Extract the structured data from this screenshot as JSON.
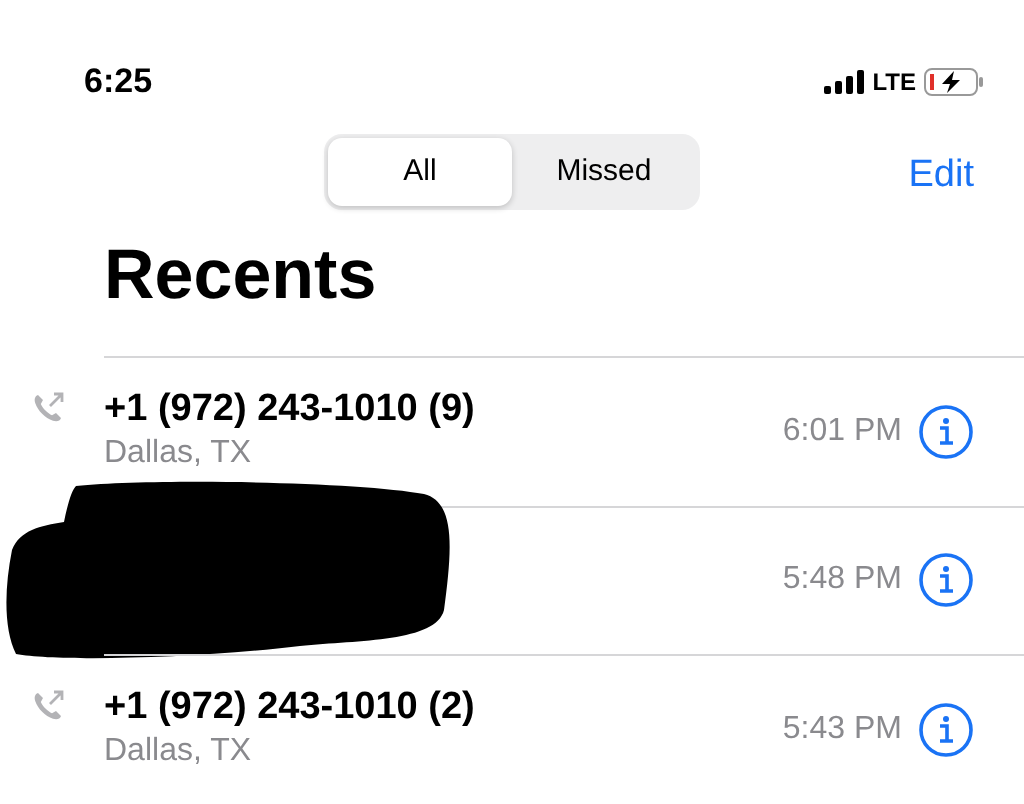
{
  "status_bar": {
    "time": "6:25",
    "network": "LTE"
  },
  "segments": [
    {
      "label": "All",
      "selected": true
    },
    {
      "label": "Missed",
      "selected": false
    }
  ],
  "edit": "Edit",
  "title": "Recents",
  "calls": [
    {
      "kind": "call",
      "name": "+1 (972) 243-1010 (9)",
      "location": "Dallas, TX",
      "time": "6:01 PM"
    },
    {
      "kind": "redacted",
      "time": "5:48 PM"
    },
    {
      "kind": "call",
      "name": "+1 (972) 243-1010 (2)",
      "location": "Dallas, TX",
      "time": "5:43 PM"
    }
  ]
}
